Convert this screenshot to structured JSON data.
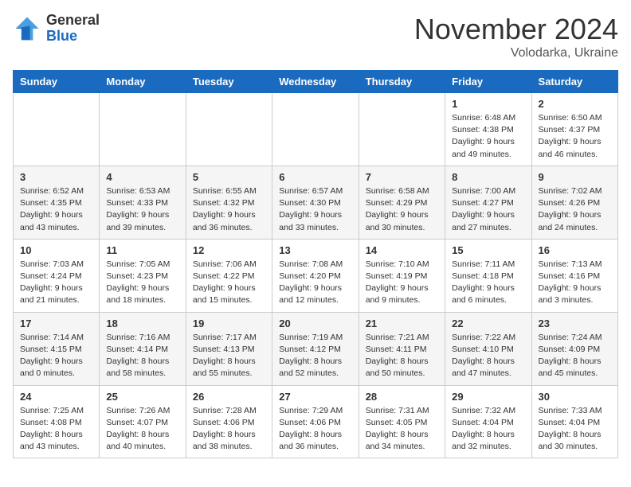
{
  "logo": {
    "general": "General",
    "blue": "Blue"
  },
  "header": {
    "month": "November 2024",
    "location": "Volodarka, Ukraine"
  },
  "weekdays": [
    "Sunday",
    "Monday",
    "Tuesday",
    "Wednesday",
    "Thursday",
    "Friday",
    "Saturday"
  ],
  "weeks": [
    [
      {
        "day": "",
        "info": ""
      },
      {
        "day": "",
        "info": ""
      },
      {
        "day": "",
        "info": ""
      },
      {
        "day": "",
        "info": ""
      },
      {
        "day": "",
        "info": ""
      },
      {
        "day": "1",
        "info": "Sunrise: 6:48 AM\nSunset: 4:38 PM\nDaylight: 9 hours and 49 minutes."
      },
      {
        "day": "2",
        "info": "Sunrise: 6:50 AM\nSunset: 4:37 PM\nDaylight: 9 hours and 46 minutes."
      }
    ],
    [
      {
        "day": "3",
        "info": "Sunrise: 6:52 AM\nSunset: 4:35 PM\nDaylight: 9 hours and 43 minutes."
      },
      {
        "day": "4",
        "info": "Sunrise: 6:53 AM\nSunset: 4:33 PM\nDaylight: 9 hours and 39 minutes."
      },
      {
        "day": "5",
        "info": "Sunrise: 6:55 AM\nSunset: 4:32 PM\nDaylight: 9 hours and 36 minutes."
      },
      {
        "day": "6",
        "info": "Sunrise: 6:57 AM\nSunset: 4:30 PM\nDaylight: 9 hours and 33 minutes."
      },
      {
        "day": "7",
        "info": "Sunrise: 6:58 AM\nSunset: 4:29 PM\nDaylight: 9 hours and 30 minutes."
      },
      {
        "day": "8",
        "info": "Sunrise: 7:00 AM\nSunset: 4:27 PM\nDaylight: 9 hours and 27 minutes."
      },
      {
        "day": "9",
        "info": "Sunrise: 7:02 AM\nSunset: 4:26 PM\nDaylight: 9 hours and 24 minutes."
      }
    ],
    [
      {
        "day": "10",
        "info": "Sunrise: 7:03 AM\nSunset: 4:24 PM\nDaylight: 9 hours and 21 minutes."
      },
      {
        "day": "11",
        "info": "Sunrise: 7:05 AM\nSunset: 4:23 PM\nDaylight: 9 hours and 18 minutes."
      },
      {
        "day": "12",
        "info": "Sunrise: 7:06 AM\nSunset: 4:22 PM\nDaylight: 9 hours and 15 minutes."
      },
      {
        "day": "13",
        "info": "Sunrise: 7:08 AM\nSunset: 4:20 PM\nDaylight: 9 hours and 12 minutes."
      },
      {
        "day": "14",
        "info": "Sunrise: 7:10 AM\nSunset: 4:19 PM\nDaylight: 9 hours and 9 minutes."
      },
      {
        "day": "15",
        "info": "Sunrise: 7:11 AM\nSunset: 4:18 PM\nDaylight: 9 hours and 6 minutes."
      },
      {
        "day": "16",
        "info": "Sunrise: 7:13 AM\nSunset: 4:16 PM\nDaylight: 9 hours and 3 minutes."
      }
    ],
    [
      {
        "day": "17",
        "info": "Sunrise: 7:14 AM\nSunset: 4:15 PM\nDaylight: 9 hours and 0 minutes."
      },
      {
        "day": "18",
        "info": "Sunrise: 7:16 AM\nSunset: 4:14 PM\nDaylight: 8 hours and 58 minutes."
      },
      {
        "day": "19",
        "info": "Sunrise: 7:17 AM\nSunset: 4:13 PM\nDaylight: 8 hours and 55 minutes."
      },
      {
        "day": "20",
        "info": "Sunrise: 7:19 AM\nSunset: 4:12 PM\nDaylight: 8 hours and 52 minutes."
      },
      {
        "day": "21",
        "info": "Sunrise: 7:21 AM\nSunset: 4:11 PM\nDaylight: 8 hours and 50 minutes."
      },
      {
        "day": "22",
        "info": "Sunrise: 7:22 AM\nSunset: 4:10 PM\nDaylight: 8 hours and 47 minutes."
      },
      {
        "day": "23",
        "info": "Sunrise: 7:24 AM\nSunset: 4:09 PM\nDaylight: 8 hours and 45 minutes."
      }
    ],
    [
      {
        "day": "24",
        "info": "Sunrise: 7:25 AM\nSunset: 4:08 PM\nDaylight: 8 hours and 43 minutes."
      },
      {
        "day": "25",
        "info": "Sunrise: 7:26 AM\nSunset: 4:07 PM\nDaylight: 8 hours and 40 minutes."
      },
      {
        "day": "26",
        "info": "Sunrise: 7:28 AM\nSunset: 4:06 PM\nDaylight: 8 hours and 38 minutes."
      },
      {
        "day": "27",
        "info": "Sunrise: 7:29 AM\nSunset: 4:06 PM\nDaylight: 8 hours and 36 minutes."
      },
      {
        "day": "28",
        "info": "Sunrise: 7:31 AM\nSunset: 4:05 PM\nDaylight: 8 hours and 34 minutes."
      },
      {
        "day": "29",
        "info": "Sunrise: 7:32 AM\nSunset: 4:04 PM\nDaylight: 8 hours and 32 minutes."
      },
      {
        "day": "30",
        "info": "Sunrise: 7:33 AM\nSunset: 4:04 PM\nDaylight: 8 hours and 30 minutes."
      }
    ]
  ]
}
